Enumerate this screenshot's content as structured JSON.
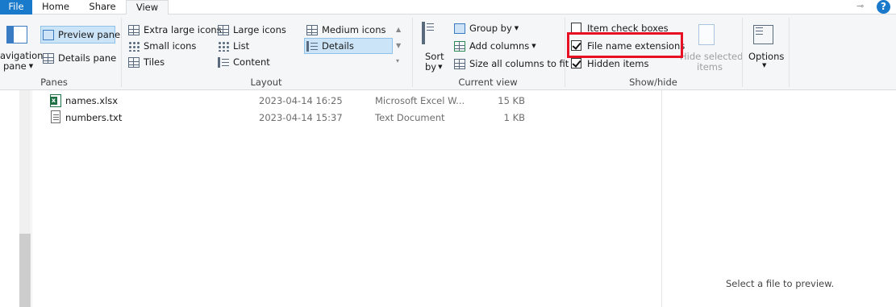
{
  "tabs": {
    "file": "File",
    "home": "Home",
    "share": "Share",
    "view": "View"
  },
  "ribbon": {
    "panes": {
      "navigation_pane_line1": "avigation",
      "navigation_pane_line2": "pane",
      "preview_pane": "Preview pane",
      "details_pane": "Details pane",
      "label": "Panes"
    },
    "layout": {
      "extra_large_icons": "Extra large icons",
      "large_icons": "Large icons",
      "medium_icons": "Medium icons",
      "small_icons": "Small icons",
      "list": "List",
      "details": "Details",
      "tiles": "Tiles",
      "content": "Content",
      "label": "Layout"
    },
    "current_view": {
      "sort_line1": "Sort",
      "sort_line2": "by",
      "group_by": "Group by",
      "add_columns": "Add columns",
      "size_columns": "Size all columns to fit",
      "label": "Current view"
    },
    "show_hide": {
      "item_check_boxes": "Item check boxes",
      "item_check_boxes_checked": false,
      "file_name_extensions": "File name extensions",
      "file_name_extensions_checked": true,
      "hidden_items": "Hidden items",
      "hidden_items_checked": true,
      "hide_selected_line1": "Hide selected",
      "hide_selected_line2": "items",
      "label": "Show/hide"
    },
    "options": "Options"
  },
  "files": [
    {
      "name": "names.xlsx",
      "date": "2023-04-14 16:25",
      "type": "Microsoft Excel W...",
      "size": "15 KB",
      "icon": "excel-file-icon"
    },
    {
      "name": "numbers.txt",
      "date": "2023-04-14 15:37",
      "type": "Text Document",
      "size": "1 KB",
      "icon": "text-file-icon"
    }
  ],
  "preview": {
    "message": "Select a file to preview."
  },
  "colors": {
    "file_tab": "#1979ca",
    "highlight": "#e81123",
    "selected": "#cce4f7"
  }
}
